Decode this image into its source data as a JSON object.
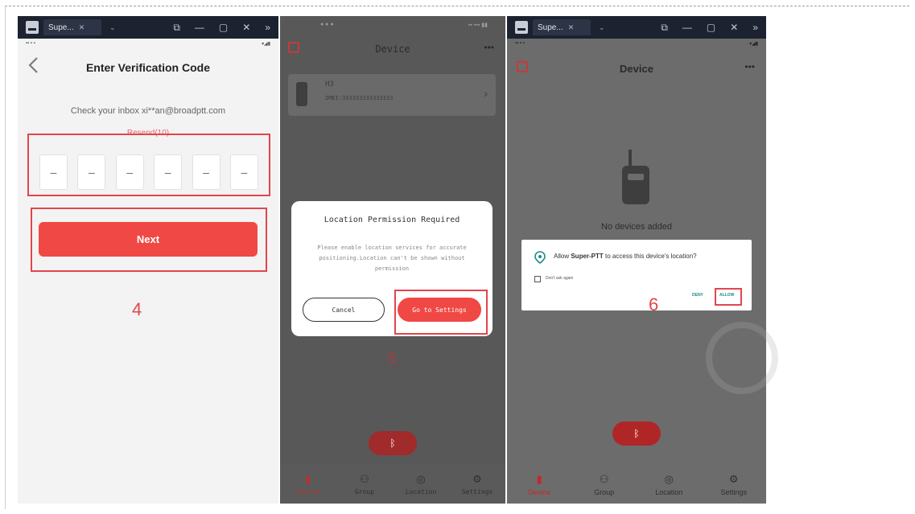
{
  "colors": {
    "accent": "#f04844",
    "highlight": "#e2454c",
    "dialog_link": "#1a8a8a"
  },
  "window": {
    "tab1_label": "Supe...",
    "tab3_label": "Supe..."
  },
  "panel1": {
    "title": "Enter Verification Code",
    "inbox_text": "Check your inbox xi**an@broadptt.com",
    "resend_text": "Resend(10)",
    "code_digits": [
      "–",
      "–",
      "–",
      "–",
      "–",
      "–"
    ],
    "next_label": "Next",
    "step_number": "4"
  },
  "panel2": {
    "title": "Device",
    "more": "•••",
    "device": {
      "name": "H3",
      "imei": "IMEI:333333333333333"
    },
    "dialog": {
      "title": "Location Permission Required",
      "message": "Please enable location services for accurate positioning.Location can't be shown without permission",
      "cancel_label": "Cancel",
      "settings_label": "Go to Settings"
    },
    "step_number": "5",
    "nav": [
      {
        "icon": "walkie-talkie-icon",
        "label": "Device"
      },
      {
        "icon": "group-icon",
        "label": "Group"
      },
      {
        "icon": "location-icon",
        "label": "Location"
      },
      {
        "icon": "settings-icon",
        "label": "Settings"
      }
    ]
  },
  "panel3": {
    "title": "Device",
    "more": "•••",
    "empty_text": "No devices added",
    "permission": {
      "prefix": "Allow ",
      "app_name": "Super-PTT",
      "suffix": " to access this device's location?",
      "dont_ask": "Don't ask again",
      "deny_label": "DENY",
      "allow_label": "ALLOW"
    },
    "step_number": "6",
    "nav": [
      {
        "icon": "walkie-talkie-icon",
        "label": "Device"
      },
      {
        "icon": "group-icon",
        "label": "Group"
      },
      {
        "icon": "location-icon",
        "label": "Location"
      },
      {
        "icon": "settings-icon",
        "label": "Settings"
      }
    ]
  }
}
